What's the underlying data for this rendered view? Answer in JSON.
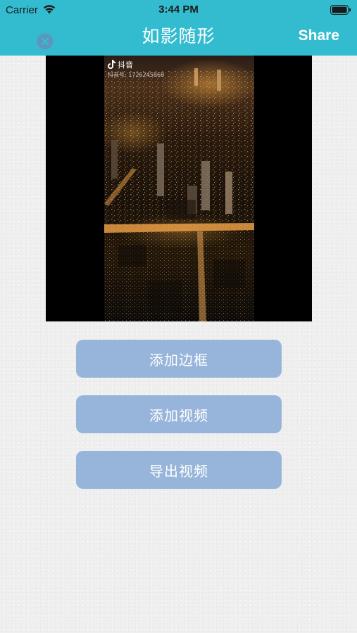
{
  "status_bar": {
    "carrier": "Carrier",
    "time": "3:44 PM"
  },
  "nav": {
    "title": "如影随形",
    "share_label": "Share",
    "close_icon": "close-circle-icon"
  },
  "preview": {
    "watermark_brand": "抖音",
    "watermark_id": "抖音号: 1726245868"
  },
  "actions": {
    "add_border": "添加边框",
    "add_video": "添加视频",
    "export_video": "导出视频"
  },
  "colors": {
    "nav_background": "#33bccf",
    "button_background": "#97b5da",
    "page_background": "#efefef"
  }
}
